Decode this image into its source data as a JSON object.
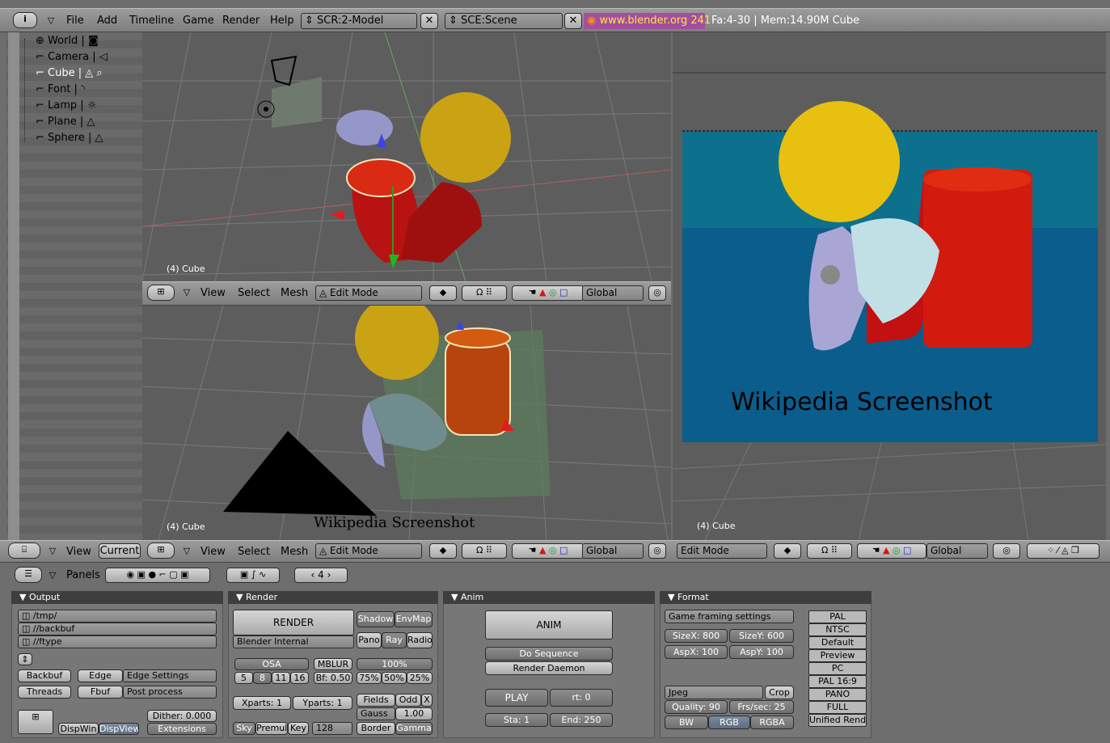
{
  "top_bar": {
    "menus": [
      "File",
      "Add",
      "Timeline",
      "Game",
      "Render",
      "Help"
    ],
    "screen_name": "SCR:2-Model",
    "scene_name": "SCE:Scene",
    "website": "www.blender.org 241",
    "status": "Fa:4-30 | Mem:14.90M Cube"
  },
  "outliner": {
    "items": [
      {
        "label": "World"
      },
      {
        "label": "Camera"
      },
      {
        "label": "Cube"
      },
      {
        "label": "Font"
      },
      {
        "label": "Lamp"
      },
      {
        "label": "Plane"
      },
      {
        "label": "Sphere"
      }
    ],
    "header": {
      "view": "View",
      "current": "Current"
    }
  },
  "viewport_top": {
    "label": "(4) Cube"
  },
  "viewport_bottom": {
    "label": "(4) Cube",
    "text3d": "Wikipedia Screenshot"
  },
  "viewport_right": {
    "label": "(4) Cube",
    "text3d": "Wikipedia Screenshot"
  },
  "view3d_header": {
    "view": "View",
    "select": "Select",
    "mesh": "Mesh",
    "mode": "Edit Mode",
    "orientation": "Global"
  },
  "buttons_header": {
    "panels": "Panels",
    "frame": "4"
  },
  "output_panel": {
    "title": "Output",
    "paths": [
      "/tmp/",
      "//backbuf",
      "//ftype"
    ],
    "backbuf": "Backbuf",
    "edge": "Edge",
    "edge_settings": "Edge Settings",
    "threads": "Threads",
    "fbuf": "Fbuf",
    "post_process": "Post process",
    "dither": "Dither: 0.000",
    "dispwin": "DispWin",
    "dispview": "DispView",
    "extensions": "Extensions"
  },
  "render_panel": {
    "title": "Render",
    "render": "RENDER",
    "shadow": "Shadow",
    "envmap": "EnvMap",
    "engine": "Blender Internal",
    "pano": "Pano",
    "ray": "Ray",
    "radio": "Radio",
    "osa": "OSA",
    "mblur": "MBLUR",
    "percent_100": "100%",
    "osa_levels": [
      "5",
      "8",
      "11",
      "16"
    ],
    "bf": "Bf: 0.50",
    "percents": [
      "75%",
      "50%",
      "25%"
    ],
    "xparts": "Xparts: 1",
    "yparts": "Yparts: 1",
    "fields": "Fields",
    "odd": "Odd",
    "x": "X",
    "gauss": "Gauss",
    "gauss_val": "1.00",
    "sky": "Sky",
    "premul": "Premul",
    "key": "Key",
    "bits": "128",
    "border": "Border",
    "gamma": "Gamma"
  },
  "anim_panel": {
    "title": "Anim",
    "anim": "ANIM",
    "do_sequence": "Do Sequence",
    "render_daemon": "Render Daemon",
    "play": "PLAY",
    "rt": "rt: 0",
    "sta": "Sta: 1",
    "end": "End: 250"
  },
  "format_panel": {
    "title": "Format",
    "game_framing": "Game framing settings",
    "sizex": "SizeX: 800",
    "sizey": "SizeY: 600",
    "aspx": "AspX: 100",
    "aspy": "AspY: 100",
    "format": "Jpeg",
    "crop": "Crop",
    "quality": "Quality: 90",
    "fps": "Frs/sec: 25",
    "bw": "BW",
    "rgb": "RGB",
    "rgba": "RGBA",
    "presets": [
      "PAL",
      "NTSC",
      "Default",
      "Preview",
      "PC",
      "PAL 16:9",
      "PANO",
      "FULL",
      "Unified Rende"
    ]
  },
  "colors": {
    "ui_gray": "#6d6d6d",
    "header": "#8f8f8f",
    "viewport": "#5e5e5e",
    "render_bg": "#0d5f86"
  }
}
